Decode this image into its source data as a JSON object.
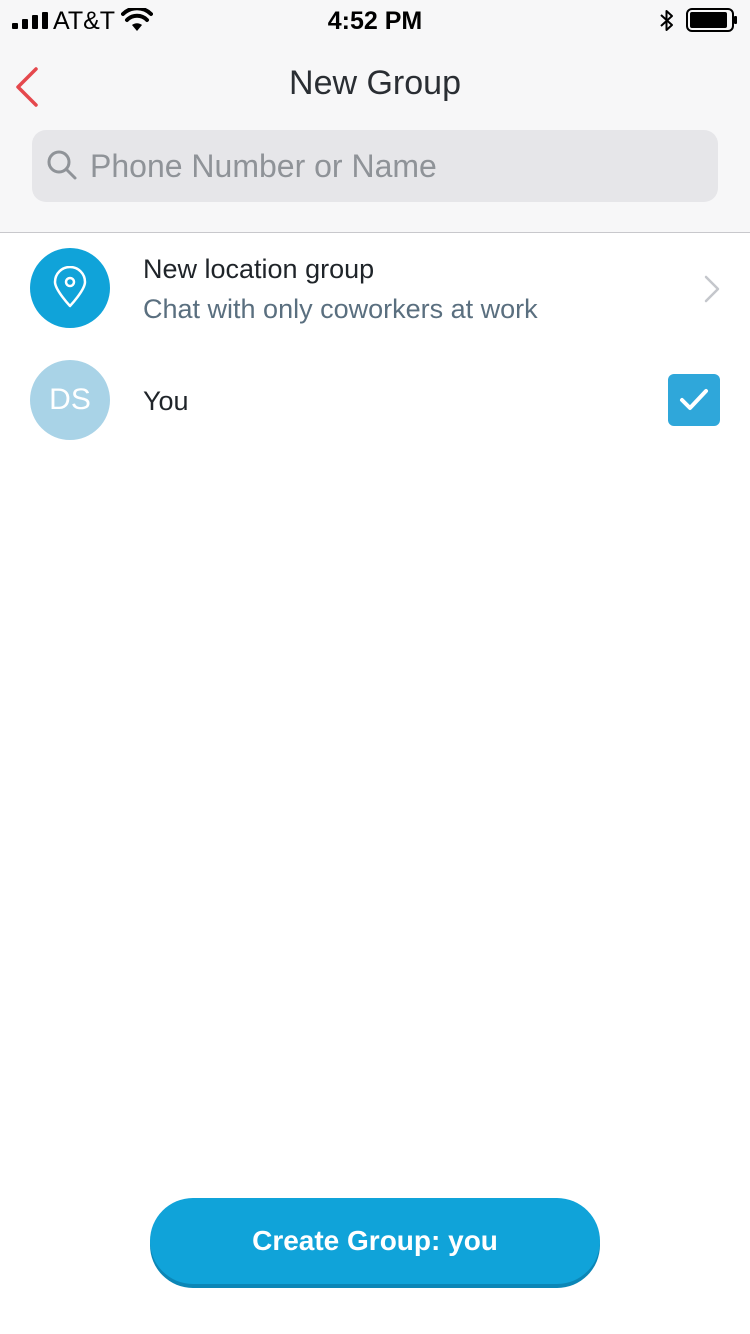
{
  "status_bar": {
    "carrier": "AT&T",
    "time": "4:52 PM"
  },
  "nav": {
    "title": "New Group"
  },
  "search": {
    "placeholder": "Phone Number or Name",
    "value": ""
  },
  "list": {
    "location_group": {
      "title": "New location group",
      "subtitle": "Chat with only coworkers at work"
    },
    "self": {
      "initials": "DS",
      "name": "You",
      "checked": true
    }
  },
  "create_button": {
    "label": "Create Group: you"
  },
  "colors": {
    "accent": "#10a3d9",
    "back_arrow": "#e5484d",
    "avatar_self": "#a9d3e7",
    "checkbox": "#2fa7da"
  }
}
